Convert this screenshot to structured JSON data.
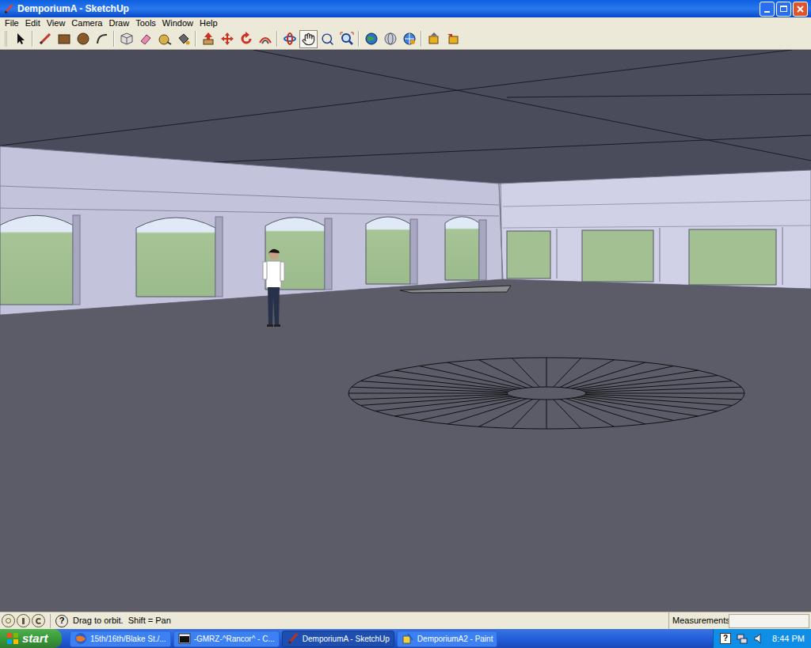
{
  "window": {
    "title": "DemporiumA - SketchUp"
  },
  "menu": [
    "File",
    "Edit",
    "View",
    "Camera",
    "Draw",
    "Tools",
    "Window",
    "Help"
  ],
  "toolbar": {
    "tools": [
      {
        "kind": "select",
        "selected": false
      },
      {
        "kind": "separator",
        "selected": false
      },
      {
        "kind": "line",
        "selected": false
      },
      {
        "kind": "rectangle",
        "selected": false
      },
      {
        "kind": "circle",
        "selected": false
      },
      {
        "kind": "arc",
        "selected": false
      },
      {
        "kind": "separator",
        "selected": false
      },
      {
        "kind": "component",
        "selected": false
      },
      {
        "kind": "eraser",
        "selected": false
      },
      {
        "kind": "tape",
        "selected": false
      },
      {
        "kind": "paint",
        "selected": false
      },
      {
        "kind": "separator",
        "selected": false
      },
      {
        "kind": "pushpull",
        "selected": false
      },
      {
        "kind": "move",
        "selected": false
      },
      {
        "kind": "rotate",
        "selected": false
      },
      {
        "kind": "offset",
        "selected": false
      },
      {
        "kind": "separator",
        "selected": false
      },
      {
        "kind": "orbit",
        "selected": false
      },
      {
        "kind": "pan",
        "selected": true
      },
      {
        "kind": "zoom",
        "selected": false
      },
      {
        "kind": "extents",
        "selected": false
      },
      {
        "kind": "separator",
        "selected": false
      },
      {
        "kind": "warehouse",
        "selected": false
      },
      {
        "kind": "share",
        "selected": false
      },
      {
        "kind": "globe",
        "selected": false
      },
      {
        "kind": "separator",
        "selected": false
      },
      {
        "kind": "getcomponent",
        "selected": false
      },
      {
        "kind": "sharecomponent",
        "selected": false
      }
    ]
  },
  "status_bar": {
    "help": "?",
    "hint": "Drag to orbit.  Shift = Pan",
    "measurements_label": "Measurements",
    "measurements_value": ""
  },
  "taskbar": {
    "start": "start",
    "items": [
      {
        "label": "15th/16th/Blake St./...",
        "kind": "browser",
        "selected": false
      },
      {
        "label": "-GMRZ-^Rancor^ - C...",
        "kind": "console",
        "selected": false
      },
      {
        "label": "DemporiumA - SketchUp",
        "kind": "sketchup",
        "selected": true
      },
      {
        "label": "DemporiumA2 - Paint",
        "kind": "paint",
        "selected": false
      }
    ],
    "tray": {
      "help": "?",
      "clock": "8:44 PM"
    }
  }
}
